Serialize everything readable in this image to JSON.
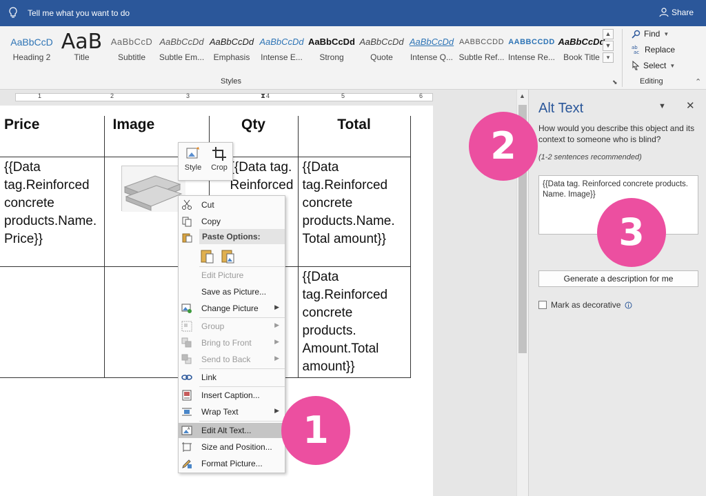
{
  "titlebar": {
    "tell_me": "Tell me what you want to do",
    "share": "Share"
  },
  "styles": [
    {
      "sample": "AaBbCcD",
      "name": "Heading 2",
      "color": "#2e74b5"
    },
    {
      "sample": "AaB",
      "name": "Title",
      "color": "#222222"
    },
    {
      "sample": "AaBbCcD",
      "name": "Subtitle",
      "color": "#666666"
    },
    {
      "sample": "AaBbCcDd",
      "name": "Subtle Em...",
      "color": "#555555"
    },
    {
      "sample": "AaBbCcDd",
      "name": "Emphasis",
      "color": "#222222"
    },
    {
      "sample": "AaBbCcDd",
      "name": "Intense E...",
      "color": "#2e74b5"
    },
    {
      "sample": "AaBbCcDd",
      "name": "Strong",
      "color": "#111111"
    },
    {
      "sample": "AaBbCcDd",
      "name": "Quote",
      "color": "#444444"
    },
    {
      "sample": "AaBbCcDd",
      "name": "Intense Q...",
      "color": "#2e74b5"
    },
    {
      "sample": "AABBCCDD",
      "name": "Subtle Ref...",
      "color": "#555555"
    },
    {
      "sample": "AABBCCDD",
      "name": "Intense Re...",
      "color": "#2e74b5"
    },
    {
      "sample": "AaBbCcDd",
      "name": "Book Title",
      "color": "#111111"
    }
  ],
  "ribbon": {
    "styles_label": "Styles",
    "editing_label": "Editing",
    "find": "Find",
    "replace": "Replace",
    "select": "Select"
  },
  "ruler": {
    "numbers": [
      "1",
      "2",
      "3",
      "4",
      "5",
      "6"
    ]
  },
  "table": {
    "headers": [
      "Price",
      "Image",
      "Qty",
      "Total"
    ],
    "row1": {
      "price": "{{Data tag.Reinforced concrete products.Name. Price}}",
      "qty": "{{Data tag. Reinforced",
      "total": "{{Data tag.Reinforced concrete products.Name. Total amount}}"
    },
    "row2": {
      "total": "{{Data tag.Reinforced concrete products. Amount.Total amount}}"
    }
  },
  "minitoolbar": {
    "style": "Style",
    "crop": "Crop"
  },
  "context_menu": {
    "cut": "Cut",
    "copy": "Copy",
    "paste_options": "Paste Options:",
    "edit_picture": "Edit Picture",
    "save_as_picture": "Save as Picture...",
    "change_picture": "Change Picture",
    "group": "Group",
    "bring_to_front": "Bring to Front",
    "send_to_back": "Send to Back",
    "link": "Link",
    "insert_caption": "Insert Caption...",
    "wrap_text": "Wrap Text",
    "edit_alt_text": "Edit Alt Text...",
    "size_and_position": "Size and Position...",
    "format_picture": "Format Picture..."
  },
  "alt_text": {
    "title": "Alt Text",
    "question": "How would you describe this object and its context to someone who is blind?",
    "recommendation": "(1-2 sentences recommended)",
    "value": "{{Data tag. Reinforced concrete products. Name. Image}}",
    "generate_button": "Generate a description for me",
    "mark_decorative": "Mark as decorative"
  },
  "callouts": [
    "1",
    "2",
    "3"
  ],
  "colors": {
    "accent": "#2b579a",
    "callout": "#ec4fa0"
  }
}
